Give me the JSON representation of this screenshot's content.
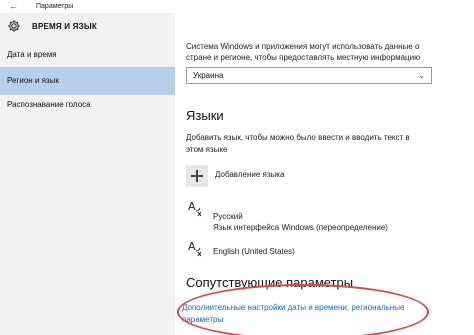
{
  "window": {
    "back_glyph": "←",
    "title": "Параметры"
  },
  "sidebar": {
    "header_label": "ВРЕМЯ И ЯЗЫК",
    "header_icon": "gear-icon",
    "items": [
      {
        "label": "Дата и время",
        "selected": false
      },
      {
        "label": "Регион и язык",
        "selected": true
      },
      {
        "label": "Распознавание голоса",
        "selected": false
      }
    ]
  },
  "main": {
    "region_description_line1": "Система Windows и приложения могут использовать данные о",
    "region_description_line2": "стране и регионе, чтобы предоставлять местную информацию",
    "country_select": {
      "value": "Украина",
      "chevron": "⌄"
    },
    "languages_heading": "Языки",
    "languages_description_line1": "Добавить язык, чтобы можно было ввести и вводить текст в",
    "languages_description_line2": "этом языке",
    "add_language_label": "Добавление языка",
    "languages": [
      {
        "name": "Русский",
        "detail": "Язык интерфейса Windows (переопределение)"
      },
      {
        "name": "English (United States)",
        "detail": ""
      }
    ],
    "related_heading": "Сопутствующие параметры",
    "related_link_line1": "Дополнительные настройки даты и времени, региональные",
    "related_link_line2": "параметры"
  },
  "colors": {
    "accent_link": "#1866c4",
    "selection": "#b6d0ec",
    "annotation_circle": "#e24545"
  }
}
